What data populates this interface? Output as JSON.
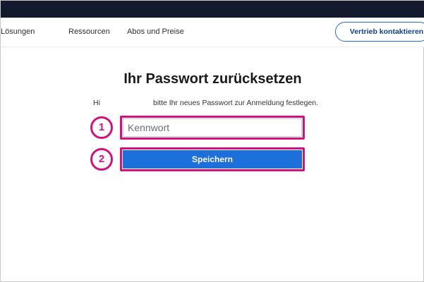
{
  "nav": {
    "links": [
      "Lösungen",
      "Ressourcen",
      "Abos und Preise"
    ],
    "cta_label": "Vertrieb kontaktieren"
  },
  "main": {
    "title": "Ihr Passwort zurücksetzen",
    "greeting": "Hi",
    "instruction": "bitte Ihr neues Passwort zur Anmeldung festlegen.",
    "password_placeholder": "Kennwort",
    "password_value": "",
    "save_label": "Speichern"
  },
  "annotations": {
    "step1": "1",
    "step2": "2"
  },
  "colors": {
    "topbar": "#141a2e",
    "accent_blue": "#1d6fd9",
    "annotation_magenta": "#d4127f"
  }
}
